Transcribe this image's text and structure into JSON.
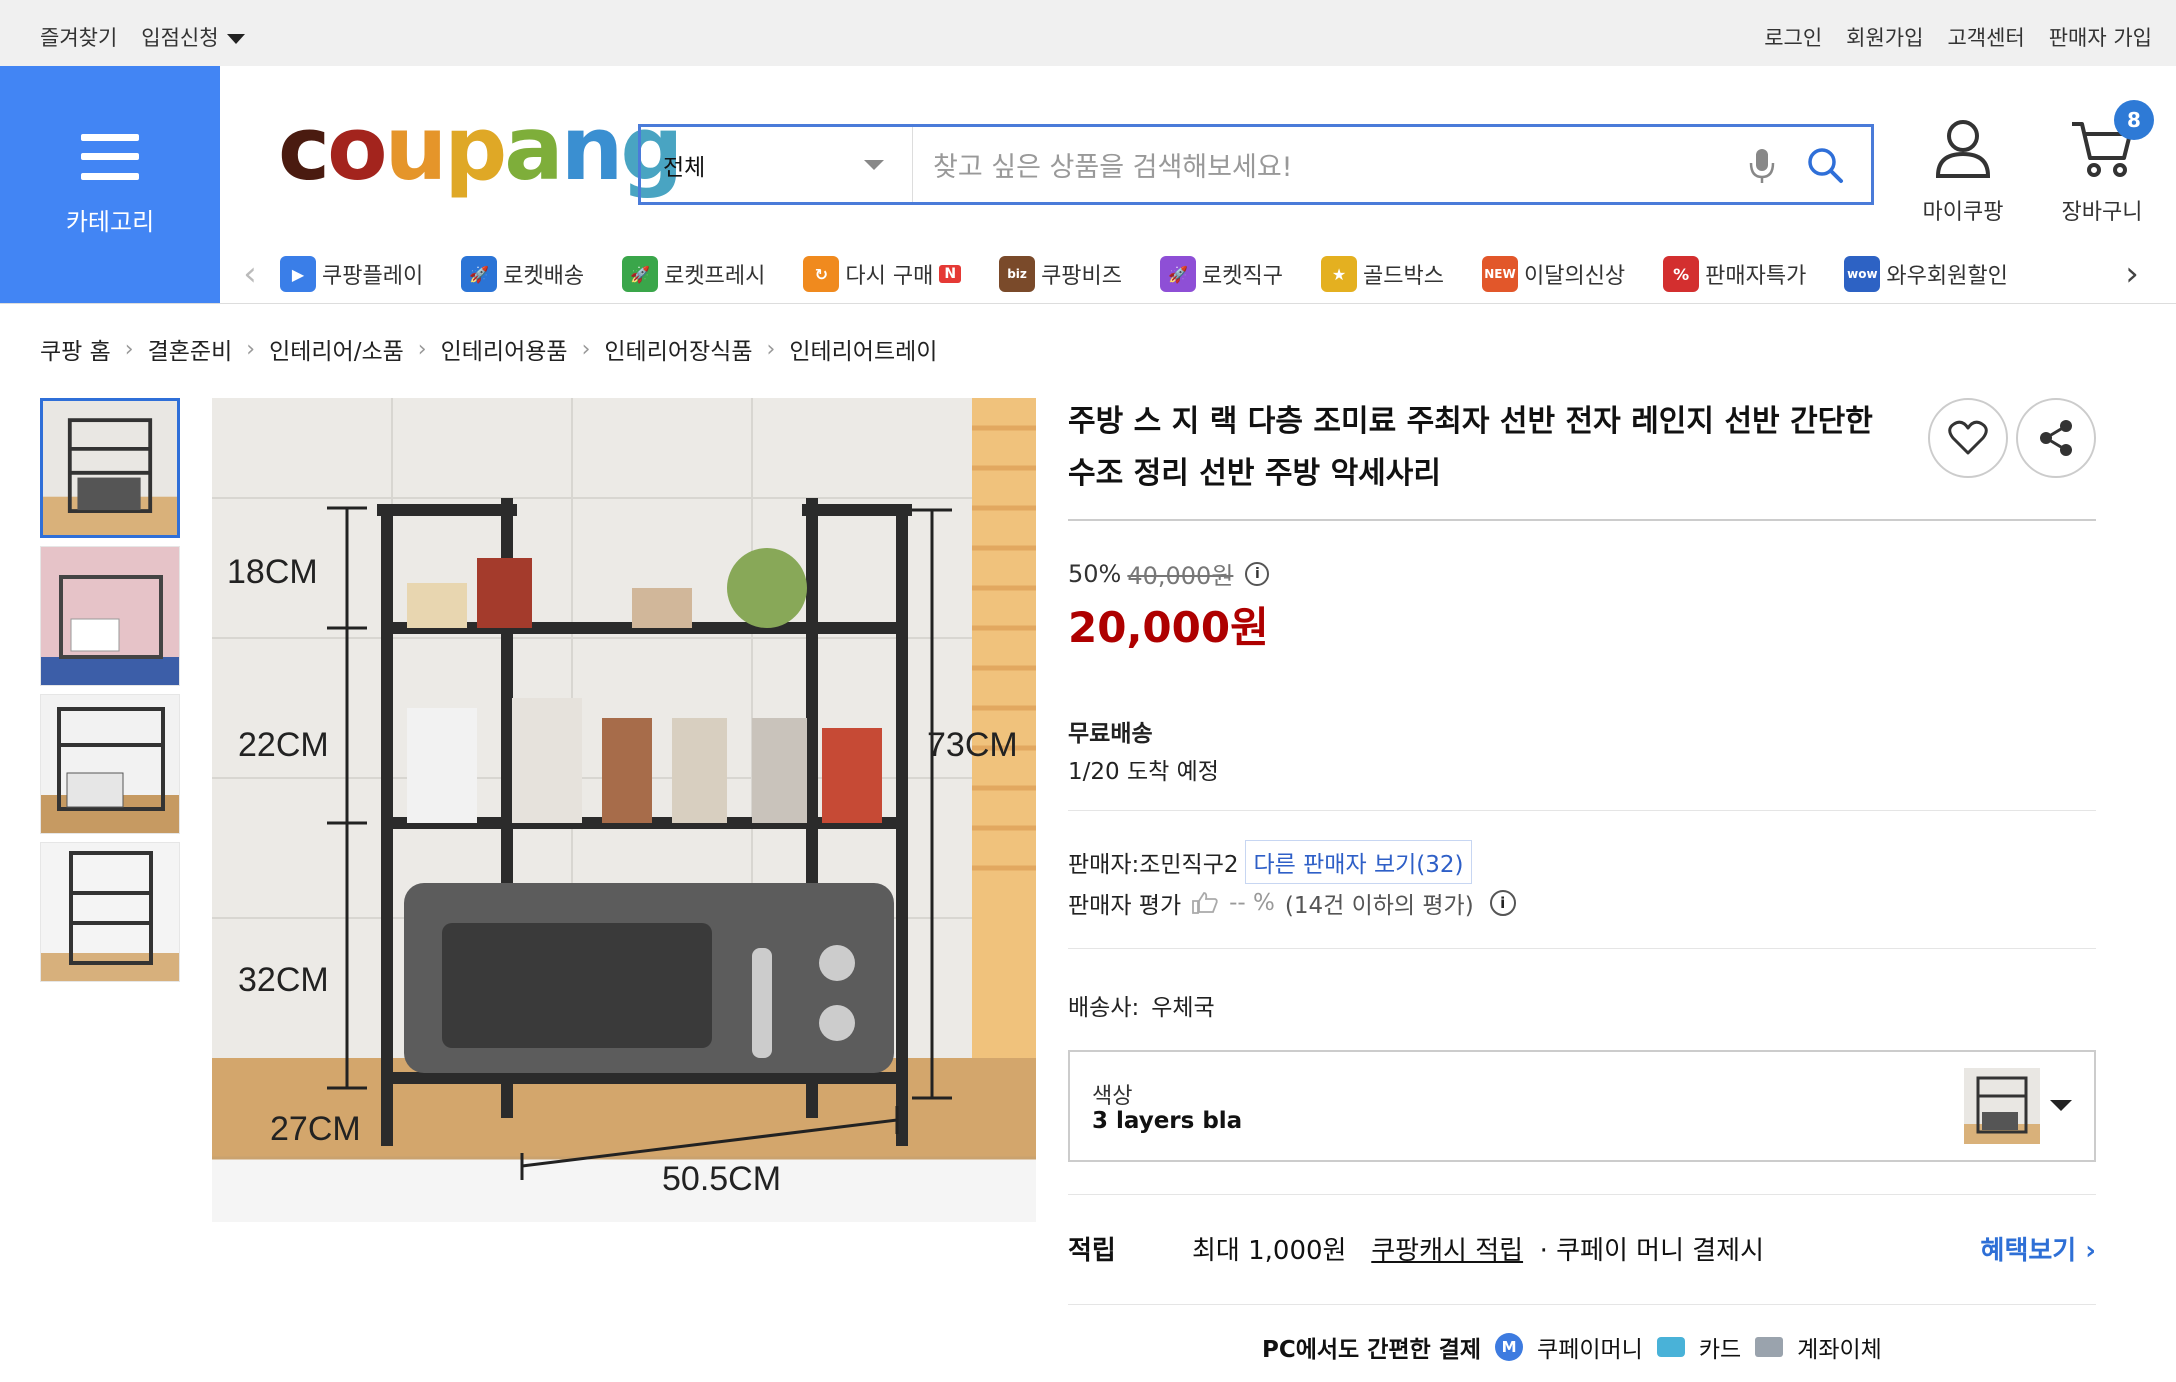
{
  "topbar": {
    "left": [
      "즐겨찾기",
      "입점신청"
    ],
    "right": [
      "로그인",
      "회원가입",
      "고객센터",
      "판매자 가입"
    ]
  },
  "header": {
    "category_label": "카테고리",
    "logo": {
      "letters": [
        "c",
        "o",
        "u",
        "p",
        "a",
        "n",
        "g"
      ],
      "colors": [
        "#4a1b10",
        "#a3241d",
        "#e5952a",
        "#dfa826",
        "#7eae3a",
        "#3a8fd1",
        "#49a4c2"
      ]
    },
    "search": {
      "scope": "전체",
      "placeholder": "찾고 싶은 상품을 검색해보세요!"
    },
    "mycoupang": "마이쿠팡",
    "cart": "장바구니",
    "cart_count": "8"
  },
  "nav": [
    {
      "label": "쿠팡플레이",
      "icon": "play-icon",
      "color": "#3a7ee8",
      "glyph": "▶"
    },
    {
      "label": "로켓배송",
      "icon": "rocket-icon",
      "color": "#2b74d6",
      "glyph": "🚀"
    },
    {
      "label": "로켓프레시",
      "icon": "rocket-fresh-icon",
      "color": "#3aa64a",
      "glyph": "🚀"
    },
    {
      "label": "다시 구매",
      "icon": "rebuy-icon",
      "color": "#f08a1e",
      "glyph": "↻",
      "badge": "N"
    },
    {
      "label": "쿠팡비즈",
      "icon": "biz-icon",
      "color": "#7a4a2a",
      "glyph": "biz"
    },
    {
      "label": "로켓직구",
      "icon": "global-rocket-icon",
      "color": "#8e4fd6",
      "glyph": "🚀"
    },
    {
      "label": "골드박스",
      "icon": "gold-box-icon",
      "color": "#e4b020",
      "glyph": "★"
    },
    {
      "label": "이달의신상",
      "icon": "new-icon",
      "color": "#e2572a",
      "glyph": "NEW"
    },
    {
      "label": "판매자특가",
      "icon": "seller-deal-icon",
      "color": "#d32f2f",
      "glyph": "%"
    },
    {
      "label": "와우회원할인",
      "icon": "wow-icon",
      "color": "#2d62c4",
      "glyph": "wow"
    }
  ],
  "breadcrumbs": [
    "쿠팡 홈",
    "결혼준비",
    "인테리어/소품",
    "인테리어용품",
    "인테리어장식품",
    "인테리어트레이"
  ],
  "product": {
    "title": "주방 스 지 랙 다층 조미료 주최자 선반 전자 레인지 선반 간단한 수조 정리 선반 주방 악세사리",
    "discount_rate": "50%",
    "original_price": "40,000원",
    "price": "20,000원",
    "shipping_label": "무료배송",
    "arrival": "1/20 도착 예정",
    "seller_label": "판매자:",
    "seller": "조민직구2",
    "other_sellers": "다른 판매자 보기(32)",
    "seller_rating_label": "판매자 평가",
    "seller_rating_value": "-- %",
    "seller_rating_note": "(14건 이하의 평가)",
    "carrier_label": "배송사:",
    "carrier": "우체국",
    "option_label": "색상",
    "option_value": "3 layers bla",
    "reward_label": "적립",
    "reward_max": "최대 1,000원",
    "reward_cash": "쿠팡캐시 적립",
    "reward_pay": "· 쿠페이 머니 결제시",
    "reward_more": "혜택보기",
    "pay_title": "PC에서도 간편한 결제",
    "pay_methods": [
      "쿠페이머니",
      "카드",
      "계좌이체"
    ]
  },
  "image_labels": {
    "h1": "18CM",
    "h2": "22CM",
    "h3": "32CM",
    "total": "73CM",
    "depth": "27CM",
    "width": "50.5CM"
  },
  "colors": {
    "brand_blue": "#4285f4",
    "price_red": "#ae0000",
    "link_blue": "#2e6fd6"
  }
}
